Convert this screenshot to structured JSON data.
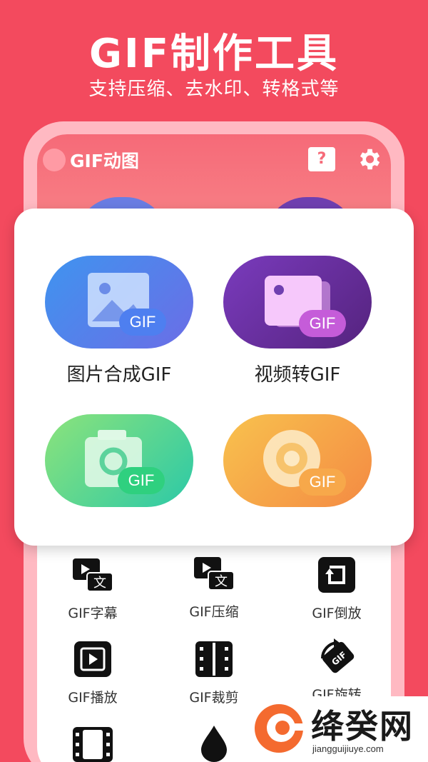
{
  "hero": {
    "title": "GIF制作工具",
    "subtitle": "支持压缩、去水印、转格式等"
  },
  "app": {
    "title": "GIF动图",
    "help_label": "?",
    "accent": "#f34a5e"
  },
  "features": [
    {
      "label": "图片合成GIF",
      "badge": "GIF",
      "icon": "image-icon"
    },
    {
      "label": "视频转GIF",
      "badge": "GIF",
      "icon": "video-icon"
    },
    {
      "label": "",
      "badge": "GIF",
      "icon": "camera-icon"
    },
    {
      "label": "",
      "badge": "GIF",
      "icon": "disc-icon"
    }
  ],
  "tools": [
    {
      "label": "GIF字幕",
      "icon": "subtitle-icon"
    },
    {
      "label": "GIF压缩",
      "icon": "compress-icon"
    },
    {
      "label": "GIF倒放",
      "icon": "reverse-icon"
    },
    {
      "label": "GIF播放",
      "icon": "play-icon"
    },
    {
      "label": "GIF裁剪",
      "icon": "crop-icon"
    },
    {
      "label": "GIF旋转",
      "icon": "rotate-icon"
    }
  ],
  "watermark": {
    "name": "绛癸网",
    "url": "jiangguijiuye.com"
  }
}
